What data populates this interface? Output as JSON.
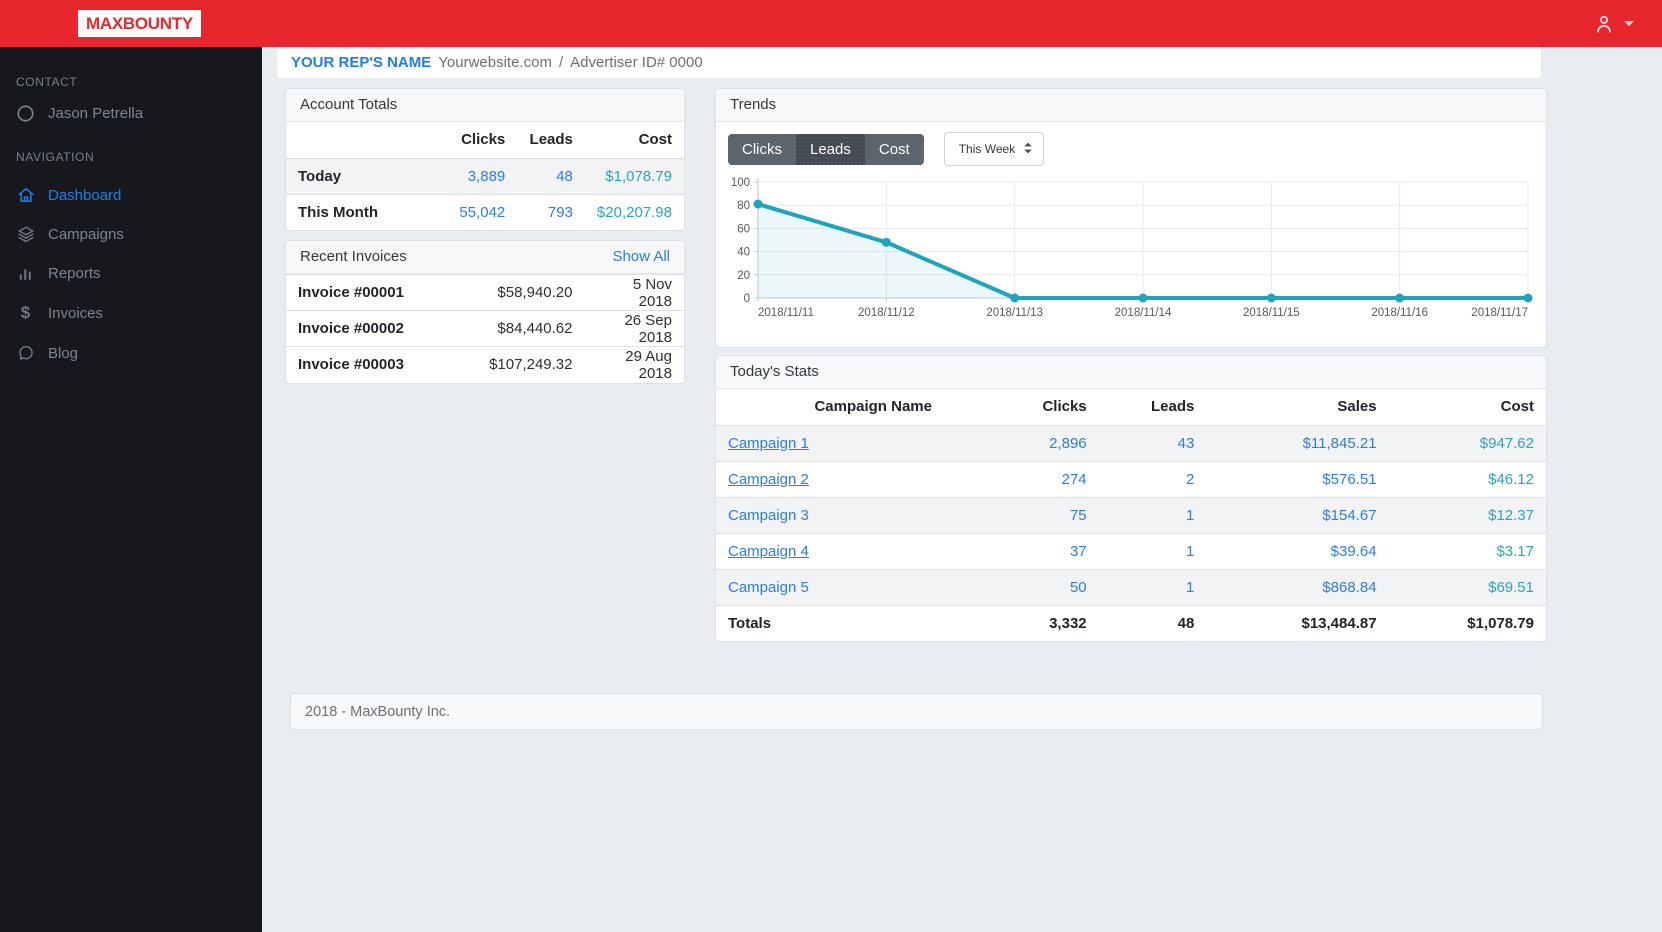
{
  "header": {
    "logo": "MAXBOUNTY"
  },
  "sidebar": {
    "contact_label": "CONTACT",
    "contact_name": "Jason Petrella",
    "navigation_label": "NAVIGATION",
    "items": [
      {
        "label": "Dashboard",
        "icon": "home-icon",
        "active": true
      },
      {
        "label": "Campaigns",
        "icon": "layers-icon",
        "active": false
      },
      {
        "label": "Reports",
        "icon": "bar-chart-icon",
        "active": false
      },
      {
        "label": "Invoices",
        "icon": "dollar-icon",
        "active": false
      },
      {
        "label": "Blog",
        "icon": "chat-bubble-icon",
        "active": false
      }
    ]
  },
  "breadcrumb": {
    "rep_name": "YOUR REP'S NAME",
    "website": "Yourwebsite.com",
    "separator": "/",
    "advertiser_id": "Advertiser ID# 0000"
  },
  "account_totals": {
    "title": "Account Totals",
    "columns": {
      "clicks": "Clicks",
      "leads": "Leads",
      "cost": "Cost"
    },
    "rows": [
      {
        "label": "Today",
        "clicks": "3,889",
        "leads": "48",
        "cost": "$1,078.79"
      },
      {
        "label": "This Month",
        "clicks": "55,042",
        "leads": "793",
        "cost": "$20,207.98"
      }
    ]
  },
  "recent_invoices": {
    "title": "Recent Invoices",
    "show_all": "Show All",
    "rows": [
      {
        "name": "Invoice #00001",
        "amount": "$58,940.20",
        "date": "5 Nov 2018"
      },
      {
        "name": "Invoice #00002",
        "amount": "$84,440.62",
        "date": "26 Sep 2018"
      },
      {
        "name": "Invoice #00003",
        "amount": "$107,249.32",
        "date": "29 Aug 2018"
      }
    ]
  },
  "trends": {
    "title": "Trends",
    "toggle": [
      "Clicks",
      "Leads",
      "Cost"
    ],
    "active_toggle": "Leads",
    "period": "This Week"
  },
  "chart_data": {
    "type": "area",
    "title": "Trends",
    "x": [
      "2018/11/11",
      "2018/11/12",
      "2018/11/13",
      "2018/11/14",
      "2018/11/15",
      "2018/11/16",
      "2018/11/17"
    ],
    "series": [
      {
        "name": "Leads",
        "values": [
          81,
          48,
          0,
          0,
          0,
          0,
          0
        ]
      }
    ],
    "xlabel": "",
    "ylabel": "",
    "ylim": [
      0,
      100
    ],
    "yticks": [
      0,
      20,
      40,
      60,
      80,
      100
    ],
    "grid": true,
    "legend": "none",
    "line_color": "#1fa4bd",
    "fill_opacity": 0.09
  },
  "todays_stats": {
    "title": "Today's Stats",
    "columns": {
      "name": "Campaign Name",
      "clicks": "Clicks",
      "leads": "Leads",
      "sales": "Sales",
      "cost": "Cost"
    },
    "rows": [
      {
        "name": "Campaign 1",
        "clicks": "2,896",
        "leads": "43",
        "sales": "$11,845.21",
        "cost": "$947.62"
      },
      {
        "name": "Campaign 2",
        "clicks": "274",
        "leads": "2",
        "sales": "$576.51",
        "cost": "$46.12"
      },
      {
        "name": "Campaign 3",
        "clicks": "75",
        "leads": "1",
        "sales": "$154.67",
        "cost": "$12.37"
      },
      {
        "name": "Campaign 4",
        "clicks": "37",
        "leads": "1",
        "sales": "$39.64",
        "cost": "$3.17"
      },
      {
        "name": "Campaign 5",
        "clicks": "50",
        "leads": "1",
        "sales": "$868.84",
        "cost": "$69.51"
      }
    ],
    "totals": {
      "label": "Totals",
      "clicks": "3,332",
      "leads": "48",
      "sales": "$13,484.87",
      "cost": "$1,078.79"
    }
  },
  "footer": {
    "text": "2018 - MaxBounty Inc."
  },
  "colors": {
    "brand_red": "#e8262d",
    "link_blue": "#2d7ce1",
    "cost_teal": "#2aa4bb",
    "chart_teal": "#1fa4bd",
    "sidebar_bg": "#16181d"
  }
}
